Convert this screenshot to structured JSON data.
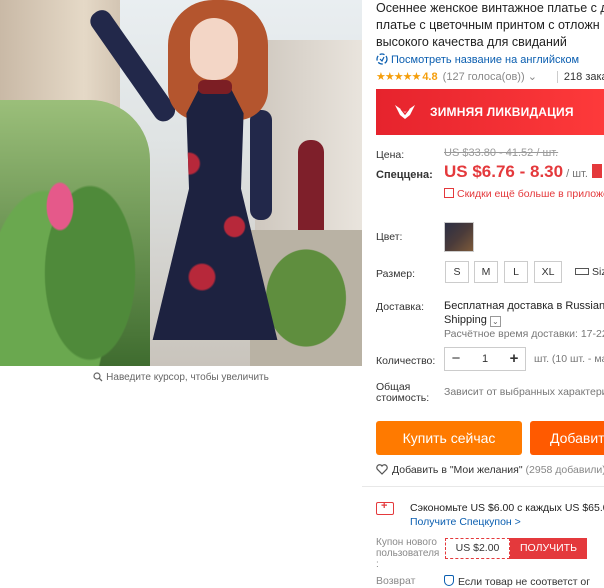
{
  "product": {
    "title_lines": [
      "Осеннее женское винтажное платье с д",
      "платье с цветочным принтом с отложн",
      "высокого качества для свиданий"
    ],
    "translate_link": "Посмотреть название на английском",
    "rating": {
      "stars": "★★★★★",
      "value": "4.8",
      "votes": "(127 голоса(ов))",
      "votes_chevron": "⌄",
      "orders": "218 заказа"
    }
  },
  "gallery": {
    "zoom_hint": "Наведите курсор, чтобы увеличить"
  },
  "banner": {
    "label": "ЗИМНЯЯ ЛИКВИДАЦИЯ"
  },
  "price": {
    "price_label": "Цена:",
    "old_price": "US $33.80 - 41.52 / шт.",
    "sale_label": "Спеццена:",
    "new_price": "US $6.76 - 8.30",
    "per_unit": "/ шт.",
    "app_discount": "Скидки ещё больше в приложе"
  },
  "options": {
    "color_label": "Цвет:",
    "size_label": "Размер:",
    "sizes": [
      "S",
      "M",
      "L",
      "XL"
    ],
    "size_chart": "Siz"
  },
  "shipping": {
    "label": "Доставка:",
    "line1": "Бесплатная доставка в Russian F",
    "line2": "Shipping",
    "chevron": "⌄",
    "estimate": "Расчётное время доставки: 17-22"
  },
  "quantity": {
    "label": "Количество:",
    "minus": "−",
    "value": "1",
    "plus": "+",
    "note": "шт. (10 шт. - ма"
  },
  "total": {
    "label_line1": "Общая",
    "label_line2": "стоимость:",
    "value": "Зависит от выбранных характери"
  },
  "actions": {
    "buy_now": "Купить сейчас",
    "add_to_cart": "Добавит",
    "wishlist": "Добавить в \"Мои желания\"",
    "wishlist_count": "(2958 добавили)",
    "wishlist_chevron": "⌄"
  },
  "coupon": {
    "save_text": "Сэкономьте US $6.00 с каждых US $65.00",
    "get_link": "Получите Спецкупон >",
    "new_user_label": "Купон нового пользователя :",
    "new_user_value": "US $2.00",
    "get_button": "ПОЛУЧИТЬ"
  },
  "returns": {
    "label": "Возврат",
    "text": "Если товар не соответст ог"
  },
  "colors": {
    "price_red": "#e4393c",
    "buy_orange": "#ff7a00",
    "link_blue": "#0a5eb0",
    "star_gold": "#f59e0b"
  }
}
